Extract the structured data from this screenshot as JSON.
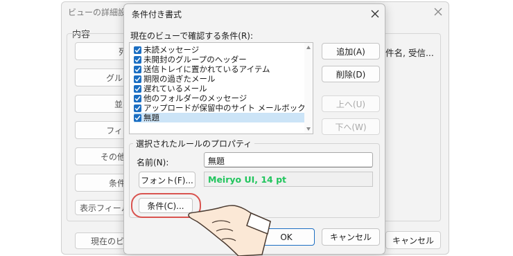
{
  "background_dialog": {
    "title": "ビューの詳細設定: ",
    "section_label": "内容",
    "buttons": [
      "列",
      "グルー",
      "並べ",
      "フィル",
      "その他の",
      "条件付",
      "表示フィールド"
    ],
    "right_text": "件名, 受信...",
    "bottom_button": "現在のビュ",
    "cancel_label": "キャンセル"
  },
  "dialog": {
    "title": "条件付き書式",
    "rules_label": "現在のビューで確認する条件(R):",
    "rules": [
      {
        "label": "未読メッセージ",
        "checked": true,
        "selected": false
      },
      {
        "label": "未開封のグループのヘッダー",
        "checked": true,
        "selected": false
      },
      {
        "label": "送信トレイに置かれているアイテム",
        "checked": true,
        "selected": false
      },
      {
        "label": "期限の過ぎたメール",
        "checked": true,
        "selected": false
      },
      {
        "label": "遅れているメール",
        "checked": true,
        "selected": false
      },
      {
        "label": "他のフォルダーのメッセージ",
        "checked": true,
        "selected": false
      },
      {
        "label": "アップロードが保留中のサイト メールボックスのドキュ",
        "checked": true,
        "selected": false
      },
      {
        "label": "無題",
        "checked": true,
        "selected": true
      }
    ],
    "add_label": "追加(A)",
    "delete_label": "削除(D)",
    "up_label": "上へ(U)",
    "down_label": "下へ(W)",
    "props_label": "選択されたルールのプロパティ",
    "name_label": "名前(N):",
    "name_value": "無題",
    "font_button": "フォント(F)...",
    "font_preview": "Meiryo UI, 14 pt",
    "font_preview_color": "#22c55e",
    "condition_button": "条件(C)...",
    "ok_label": "OK",
    "cancel_label": "キャンセル"
  },
  "annotation": {
    "highlight_color": "#d9534f",
    "pointer": "hand-pointer-icon"
  }
}
